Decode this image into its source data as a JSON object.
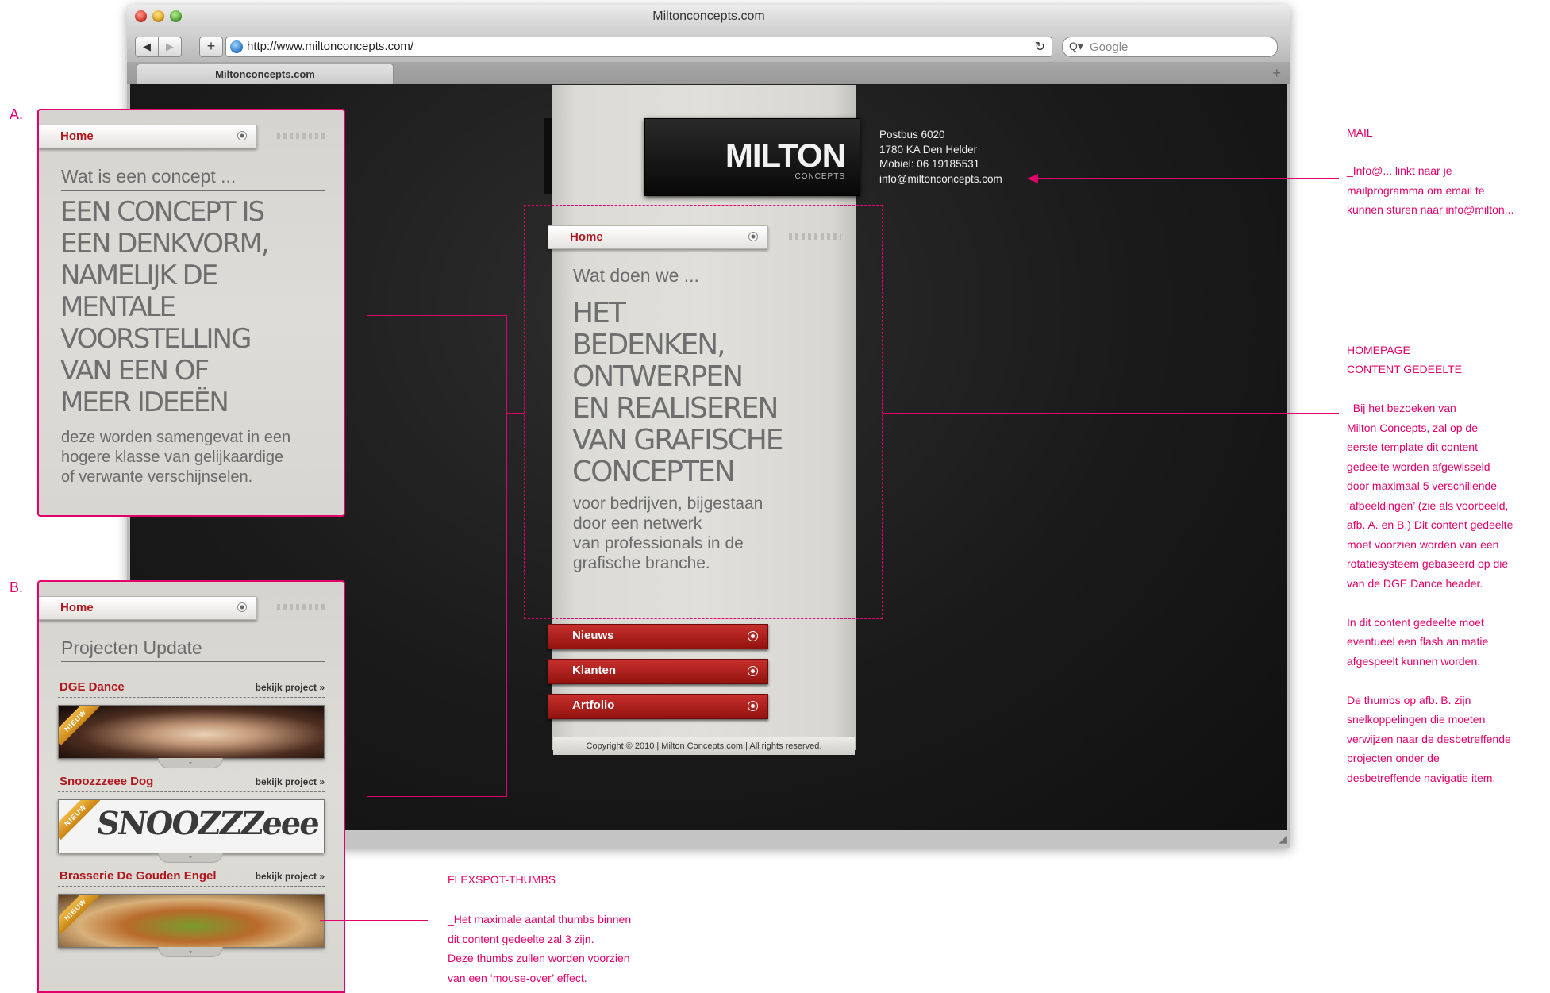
{
  "browser": {
    "window_title": "Miltonconcepts.com",
    "url": "http://www.miltonconcepts.com/",
    "search_placeholder": "Google",
    "tab_title": "Miltonconcepts.com",
    "back_glyph": "◀",
    "forward_glyph": "▶",
    "add_glyph": "+",
    "reload_glyph": "↻",
    "newtab_glyph": "+",
    "search_glyph": "Q▾",
    "resize_glyph": "◢"
  },
  "site": {
    "logo": {
      "main": "MILTON",
      "sub": "CONCEPTS"
    },
    "contact": [
      "Postbus 6020",
      "1780 KA Den Helder",
      "Mobiel: 06 19185531",
      "info@miltonconcepts.com"
    ],
    "home_tab_label": "Home",
    "content": {
      "heading": "Wat doen we ...",
      "big_lines": [
        "HET",
        "BEDENKEN,",
        "ONTWERPEN",
        "EN REALISEREN",
        "VAN GRAFISCHE",
        "CONCEPTEN"
      ],
      "body_lines": [
        "voor bedrijven, bijgestaan",
        "door een netwerk",
        "van professionals in de",
        "grafische branche."
      ]
    },
    "nav_buttons": [
      "Nieuws",
      "Klanten",
      "Artfolio"
    ],
    "copyright": "Copyright © 2010 | Milton Concepts.com | All rights reserved."
  },
  "card_a": {
    "letter": "A.",
    "home_label": "Home",
    "heading": "Wat is een concept ...",
    "big_lines": [
      "EEN CONCEPT IS",
      "EEN DENKVORM,",
      "NAMELIJK DE",
      "MENTALE",
      "VOORSTELLING",
      "VAN EEN OF",
      "MEER IDEEËN"
    ],
    "body_lines": [
      "deze worden samengevat in een",
      "hogere klasse van gelijkaardige",
      "of verwante verschijnselen."
    ]
  },
  "card_b": {
    "letter": "B.",
    "home_label": "Home",
    "heading": "Projecten Update",
    "projects": [
      {
        "title": "DGE Dance",
        "link": "bekijk project »",
        "badge": "NIEUW"
      },
      {
        "title": "Snoozzzeee Dog",
        "link": "bekijk project »",
        "badge": "NIEUW",
        "thumb_text": "SNOOZZZeee"
      },
      {
        "title": "Brasserie De Gouden Engel",
        "link": "bekijk project »",
        "badge": "NIEUW"
      }
    ]
  },
  "annotations": {
    "mail": {
      "title": "MAIL",
      "lines": [
        "_Info@... linkt naar je",
        "mailprogramma om email te",
        "kunnen sturen naar info@milton..."
      ]
    },
    "homepage": {
      "title_lines": [
        "HOMEPAGE",
        "CONTENT GEDEELTE"
      ],
      "lines": [
        "_Bij het bezoeken van",
        "Milton Concepts, zal op de",
        "eerste template dit content",
        "gedeelte worden afgewisseld",
        "door maximaal 5 verschillende",
        "‘afbeeldingen’ (zie als voorbeeld,",
        "afb. A. en B.) Dit content gedeelte",
        "moet voorzien worden van een",
        "rotatiesysteem gebaseerd op die",
        "van de DGE Dance header.",
        "",
        "In dit content gedeelte moet",
        "eventueel een flash animatie",
        "afgespeelt kunnen worden.",
        "",
        "De thumbs op afb. B. zijn",
        "snelkoppelingen die moeten",
        "verwijzen naar de desbetreffende",
        "projecten onder de",
        "desbetreffende navigatie item."
      ]
    },
    "flexspot": {
      "title": "FLEXSPOT-THUMBS",
      "lines": [
        "_Het maximale aantal thumbs binnen",
        "dit content gedeelte zal 3 zijn.",
        "Deze thumbs zullen worden voorzien",
        "van een ‘mouse-over’ effect."
      ]
    }
  },
  "colors": {
    "annotation": "#e2006a",
    "accent_red": "#b0171d",
    "button_red": "#a91c18"
  }
}
